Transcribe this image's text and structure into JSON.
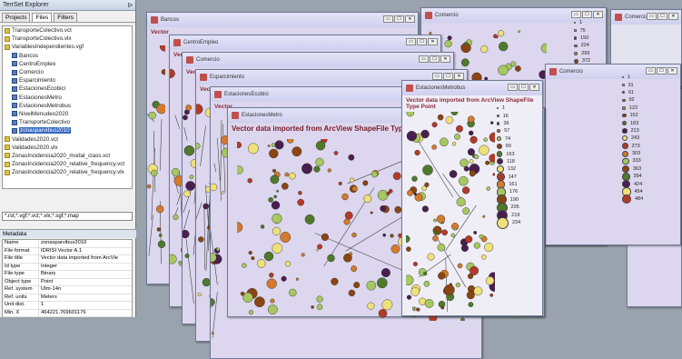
{
  "explorer": {
    "title": "TerrSet Explorer",
    "tabs": [
      "Projects",
      "Files",
      "Filters"
    ],
    "tree": [
      {
        "label": "TransporteColectivo.vct",
        "indent": 0,
        "dir": false
      },
      {
        "label": "TransporteColectivo.vlx",
        "indent": 0,
        "dir": false
      },
      {
        "label": "VariablesIndependientes.vgf",
        "indent": 0,
        "dir": false
      },
      {
        "label": "Bancos",
        "indent": 1,
        "dir": true
      },
      {
        "label": "CentroEmpleo",
        "indent": 1,
        "dir": true
      },
      {
        "label": "Comercio",
        "indent": 1,
        "dir": true
      },
      {
        "label": "Esparcimiento",
        "indent": 1,
        "dir": true
      },
      {
        "label": "EstacionesEcobici",
        "indent": 1,
        "dir": true
      },
      {
        "label": "EstacionesMetro",
        "indent": 1,
        "dir": true
      },
      {
        "label": "EstacionesMetrobus",
        "indent": 1,
        "dir": true
      },
      {
        "label": "NivelMenudeo2020",
        "indent": 1,
        "dir": true
      },
      {
        "label": "TransporteColectivo",
        "indent": 1,
        "dir": true
      },
      {
        "label": "zonasparvibus2010",
        "indent": 1,
        "dir": true,
        "selected": true
      },
      {
        "label": "Validades2020.vct",
        "indent": 0,
        "dir": false
      },
      {
        "label": "Validades2020.vlx",
        "indent": 0,
        "dir": false
      },
      {
        "label": "ZonasIncidencia2020_modal_class.vct",
        "indent": 0,
        "dir": false
      },
      {
        "label": "ZonasIncidencia2020_relative_frequency.vct",
        "indent": 0,
        "dir": false
      },
      {
        "label": "ZonasIncidencia2020_relative_frequency.vlx",
        "indent": 0,
        "dir": false
      }
    ],
    "filter": "*.rst;*.vgf;*.vct;*.vlx;*.sgf;*.map",
    "metadata_title": "Metadata",
    "metadata": [
      {
        "k": "Name",
        "v": "zonasparvibus2010"
      },
      {
        "k": "File format",
        "v": "IDRISI Vector A.1"
      },
      {
        "k": "File title",
        "v": "Vector data imported from ArcVie"
      },
      {
        "k": "Id type",
        "v": "Integer"
      },
      {
        "k": "File type",
        "v": "Binary"
      },
      {
        "k": "Object type",
        "v": "Point"
      },
      {
        "k": "Ref. system",
        "v": "Utm-14n"
      },
      {
        "k": "Ref. units",
        "v": "Meters"
      },
      {
        "k": "Unit dist.",
        "v": "1"
      },
      {
        "k": "Min. X",
        "v": "464221.769601176"
      }
    ]
  },
  "windows": [
    {
      "title": "Bancos",
      "subtitle": "Vector"
    },
    {
      "title": "CentroEmpleo",
      "subtitle": "Vector"
    },
    {
      "title": "Comercio",
      "subtitle": "Vector"
    },
    {
      "title": "Esparcimiento",
      "subtitle": "Vector"
    },
    {
      "title": "EstacionesEcobici",
      "subtitle": "Vector"
    },
    {
      "title": "EstacionesMetro",
      "subtitle": "Vector data imported from ArcView ShapeFile Type Point"
    },
    {
      "title": "TransporteColectivo",
      "subtitle": ""
    },
    {
      "title": "Comercio",
      "subtitle": ""
    },
    {
      "title": "EstacionesMetrobus",
      "subtitle": "Vector data imported from ArcView ShapeFile Type Point"
    }
  ],
  "legend_metrobus": [
    "1",
    "16",
    "36",
    "57",
    "74",
    "99",
    "163",
    "118",
    "132",
    "147",
    "161",
    "176",
    "190",
    "205",
    "219",
    "234"
  ],
  "legend_back": [
    "1",
    "75",
    "150",
    "224",
    "299",
    "372",
    "447",
    "521",
    "595",
    "669",
    "744",
    "818",
    "892",
    "966",
    "1041",
    "1115",
    "1189"
  ],
  "legend_right": [
    "1",
    "31",
    "61",
    "92",
    "122",
    "152",
    "183",
    "213",
    "243",
    "273",
    "303",
    "333",
    "363",
    "394",
    "424",
    "454",
    "484"
  ],
  "legend_far": [
    "1",
    "44",
    "88",
    "131",
    "175",
    "218",
    "262",
    "305",
    "349",
    "393",
    "436",
    "480",
    "523",
    "567",
    "610",
    "654",
    "697"
  ],
  "colors": {
    "dark": "#4a1f4f",
    "brown": "#8b4513",
    "orange": "#d47a2c",
    "yellow": "#f0e07a",
    "green": "#4f7a2c",
    "lightgreen": "#a6c761",
    "red": "#b23a2a"
  }
}
